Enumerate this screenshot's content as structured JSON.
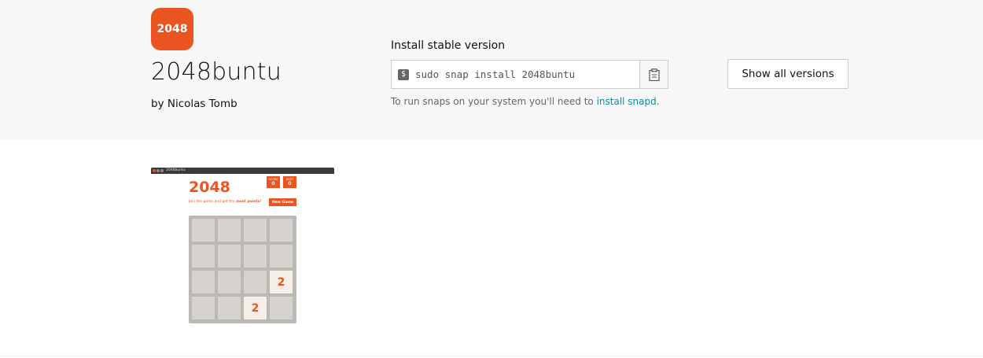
{
  "app": {
    "icon_text": "2048",
    "title": "2048buntu",
    "publisher": "by Nicolas Tomb"
  },
  "install": {
    "label": "Install stable version",
    "prompt_symbol": "$",
    "command": "sudo snap install 2048buntu",
    "note_prefix": "To run snaps on your system you'll need to ",
    "note_link": "install snapd",
    "note_suffix": ".",
    "copy_icon": "clipboard-icon"
  },
  "versions_button": "Show all versions",
  "screenshot": {
    "window_title": "2048buntu",
    "game_title": "2048",
    "score_label": "SCORE",
    "score_value": "0",
    "best_label": "BEST",
    "best_value": "0",
    "intro_prefix": "Join the game and get the ",
    "intro_bold": "most points!",
    "new_game": "New Game",
    "board": [
      [
        "",
        "",
        "",
        ""
      ],
      [
        "",
        "",
        "",
        ""
      ],
      [
        "",
        "",
        "",
        "2"
      ],
      [
        "",
        "",
        "2",
        ""
      ]
    ]
  },
  "colors": {
    "brand": "#e95420",
    "link": "#0e8ba0",
    "hero_bg": "#f7f7f7"
  }
}
